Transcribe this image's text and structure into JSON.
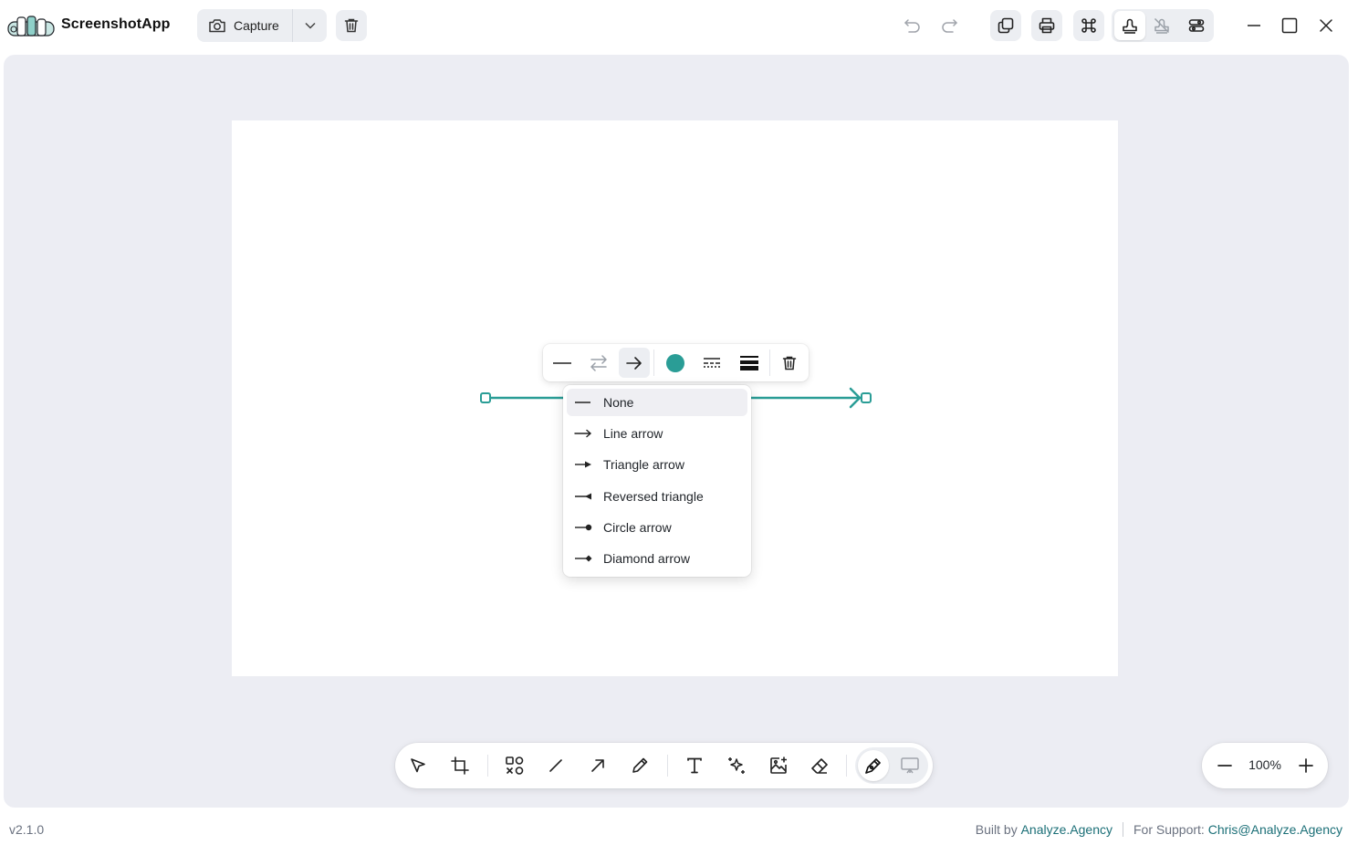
{
  "app": {
    "name": "ScreenshotApp"
  },
  "header": {
    "capture_label": "Capture",
    "icons": [
      "camera-icon",
      "chevron-down-icon",
      "trash-icon",
      "undo-icon",
      "redo-icon",
      "copy-icon",
      "print-icon",
      "command-icon",
      "stamp-icon",
      "stamp-disabled-icon",
      "settings-sliders-icon",
      "minimize-icon",
      "maximize-icon",
      "close-icon"
    ]
  },
  "colors": {
    "accent": "#2a9d96",
    "workspace": "#ecedf3"
  },
  "style_toolbar": {
    "icons": [
      "line-none-icon",
      "swap-direction-icon",
      "arrow-end-icon",
      "color-swatch-icon",
      "line-style-icon",
      "line-width-icon",
      "trash-icon"
    ],
    "color": "#2a9d96"
  },
  "arrow_menu": {
    "items": [
      {
        "label": "None",
        "icon": "line-none-icon",
        "highlighted": true
      },
      {
        "label": "Line arrow",
        "icon": "line-arrow-icon"
      },
      {
        "label": "Triangle arrow",
        "icon": "triangle-arrow-icon"
      },
      {
        "label": "Reversed triangle",
        "icon": "reversed-triangle-icon"
      },
      {
        "label": "Circle arrow",
        "icon": "circle-arrow-icon"
      },
      {
        "label": "Diamond arrow",
        "icon": "diamond-arrow-icon"
      }
    ]
  },
  "tools": {
    "icons": [
      "select-icon",
      "crop-icon",
      "shapes-icon",
      "line-icon",
      "arrow-icon",
      "pencil-icon",
      "text-icon",
      "sparkles-icon",
      "image-add-icon",
      "eraser-icon",
      "pen-icon",
      "presentation-icon"
    ]
  },
  "zoom": {
    "value": "100%"
  },
  "footer": {
    "version": "v2.1.0",
    "built_by_label": "Built by",
    "built_by_link": "Analyze.Agency",
    "support_label": "For Support:",
    "support_link": "Chris@Analyze.Agency"
  }
}
